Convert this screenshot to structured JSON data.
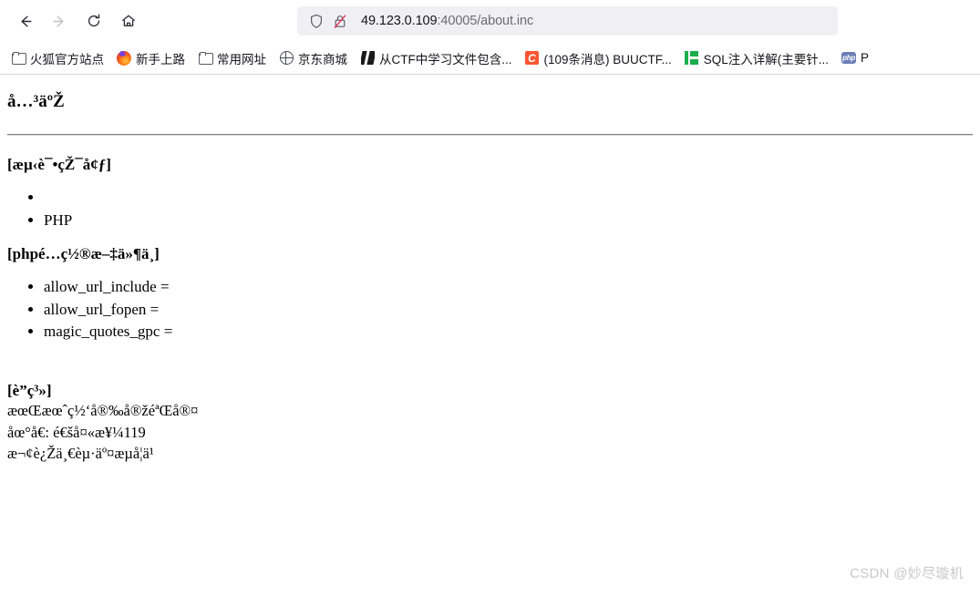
{
  "browser": {
    "nav": {
      "back_icon": "back-arrow-icon",
      "forward_icon": "forward-arrow-icon",
      "reload_icon": "reload-icon",
      "home_icon": "home-icon"
    },
    "urlbar": {
      "shield_icon": "shield-icon",
      "lock_icon": "lock-crossed-out-icon",
      "host": "49.123.0.109",
      "rest": ":40005/about.inc",
      "full_url": "49.123.0.109:40005/about.inc"
    },
    "bookmarks": [
      {
        "label": "火狐官方站点",
        "icon": "folder-icon"
      },
      {
        "label": "新手上路",
        "icon": "firefox-icon"
      },
      {
        "label": "常用网址",
        "icon": "folder-icon"
      },
      {
        "label": "京东商城",
        "icon": "globe-icon"
      },
      {
        "label": "从CTF中学习文件包含...",
        "icon": "ctf-icon"
      },
      {
        "label": "(109条消息) BUUCTF...",
        "icon": "csdn-icon",
        "icon_text": "C"
      },
      {
        "label": "SQL注入详解(主要针...",
        "icon": "sql-icon"
      },
      {
        "label": "P",
        "icon": "php-icon",
        "icon_text": "php"
      }
    ]
  },
  "page": {
    "heading": "å…³äºŽ",
    "env_section": {
      "title": "[æµ‹è¯•çŽ¯å¢ƒ]",
      "items": [
        "",
        "PHP"
      ]
    },
    "php_section": {
      "title": "[phpé…ç½®æ–‡ä»¶ä¸­]",
      "items": [
        "allow_url_include =",
        "allow_url_fopen =",
        "magic_quotes_gpc ="
      ]
    },
    "contact_section": {
      "title": "[è”ç³»]",
      "lines": [
        "æœŒæœˆç½‘å®‰å®žéªŒå®¤",
        "åœ°å€: é€šå¤«æ¥¼119",
        "æ¬¢è¿Žä¸€èµ·äº¤æµå¦ä¹ "
      ]
    },
    "watermark": "CSDN @妙尽璇机"
  }
}
